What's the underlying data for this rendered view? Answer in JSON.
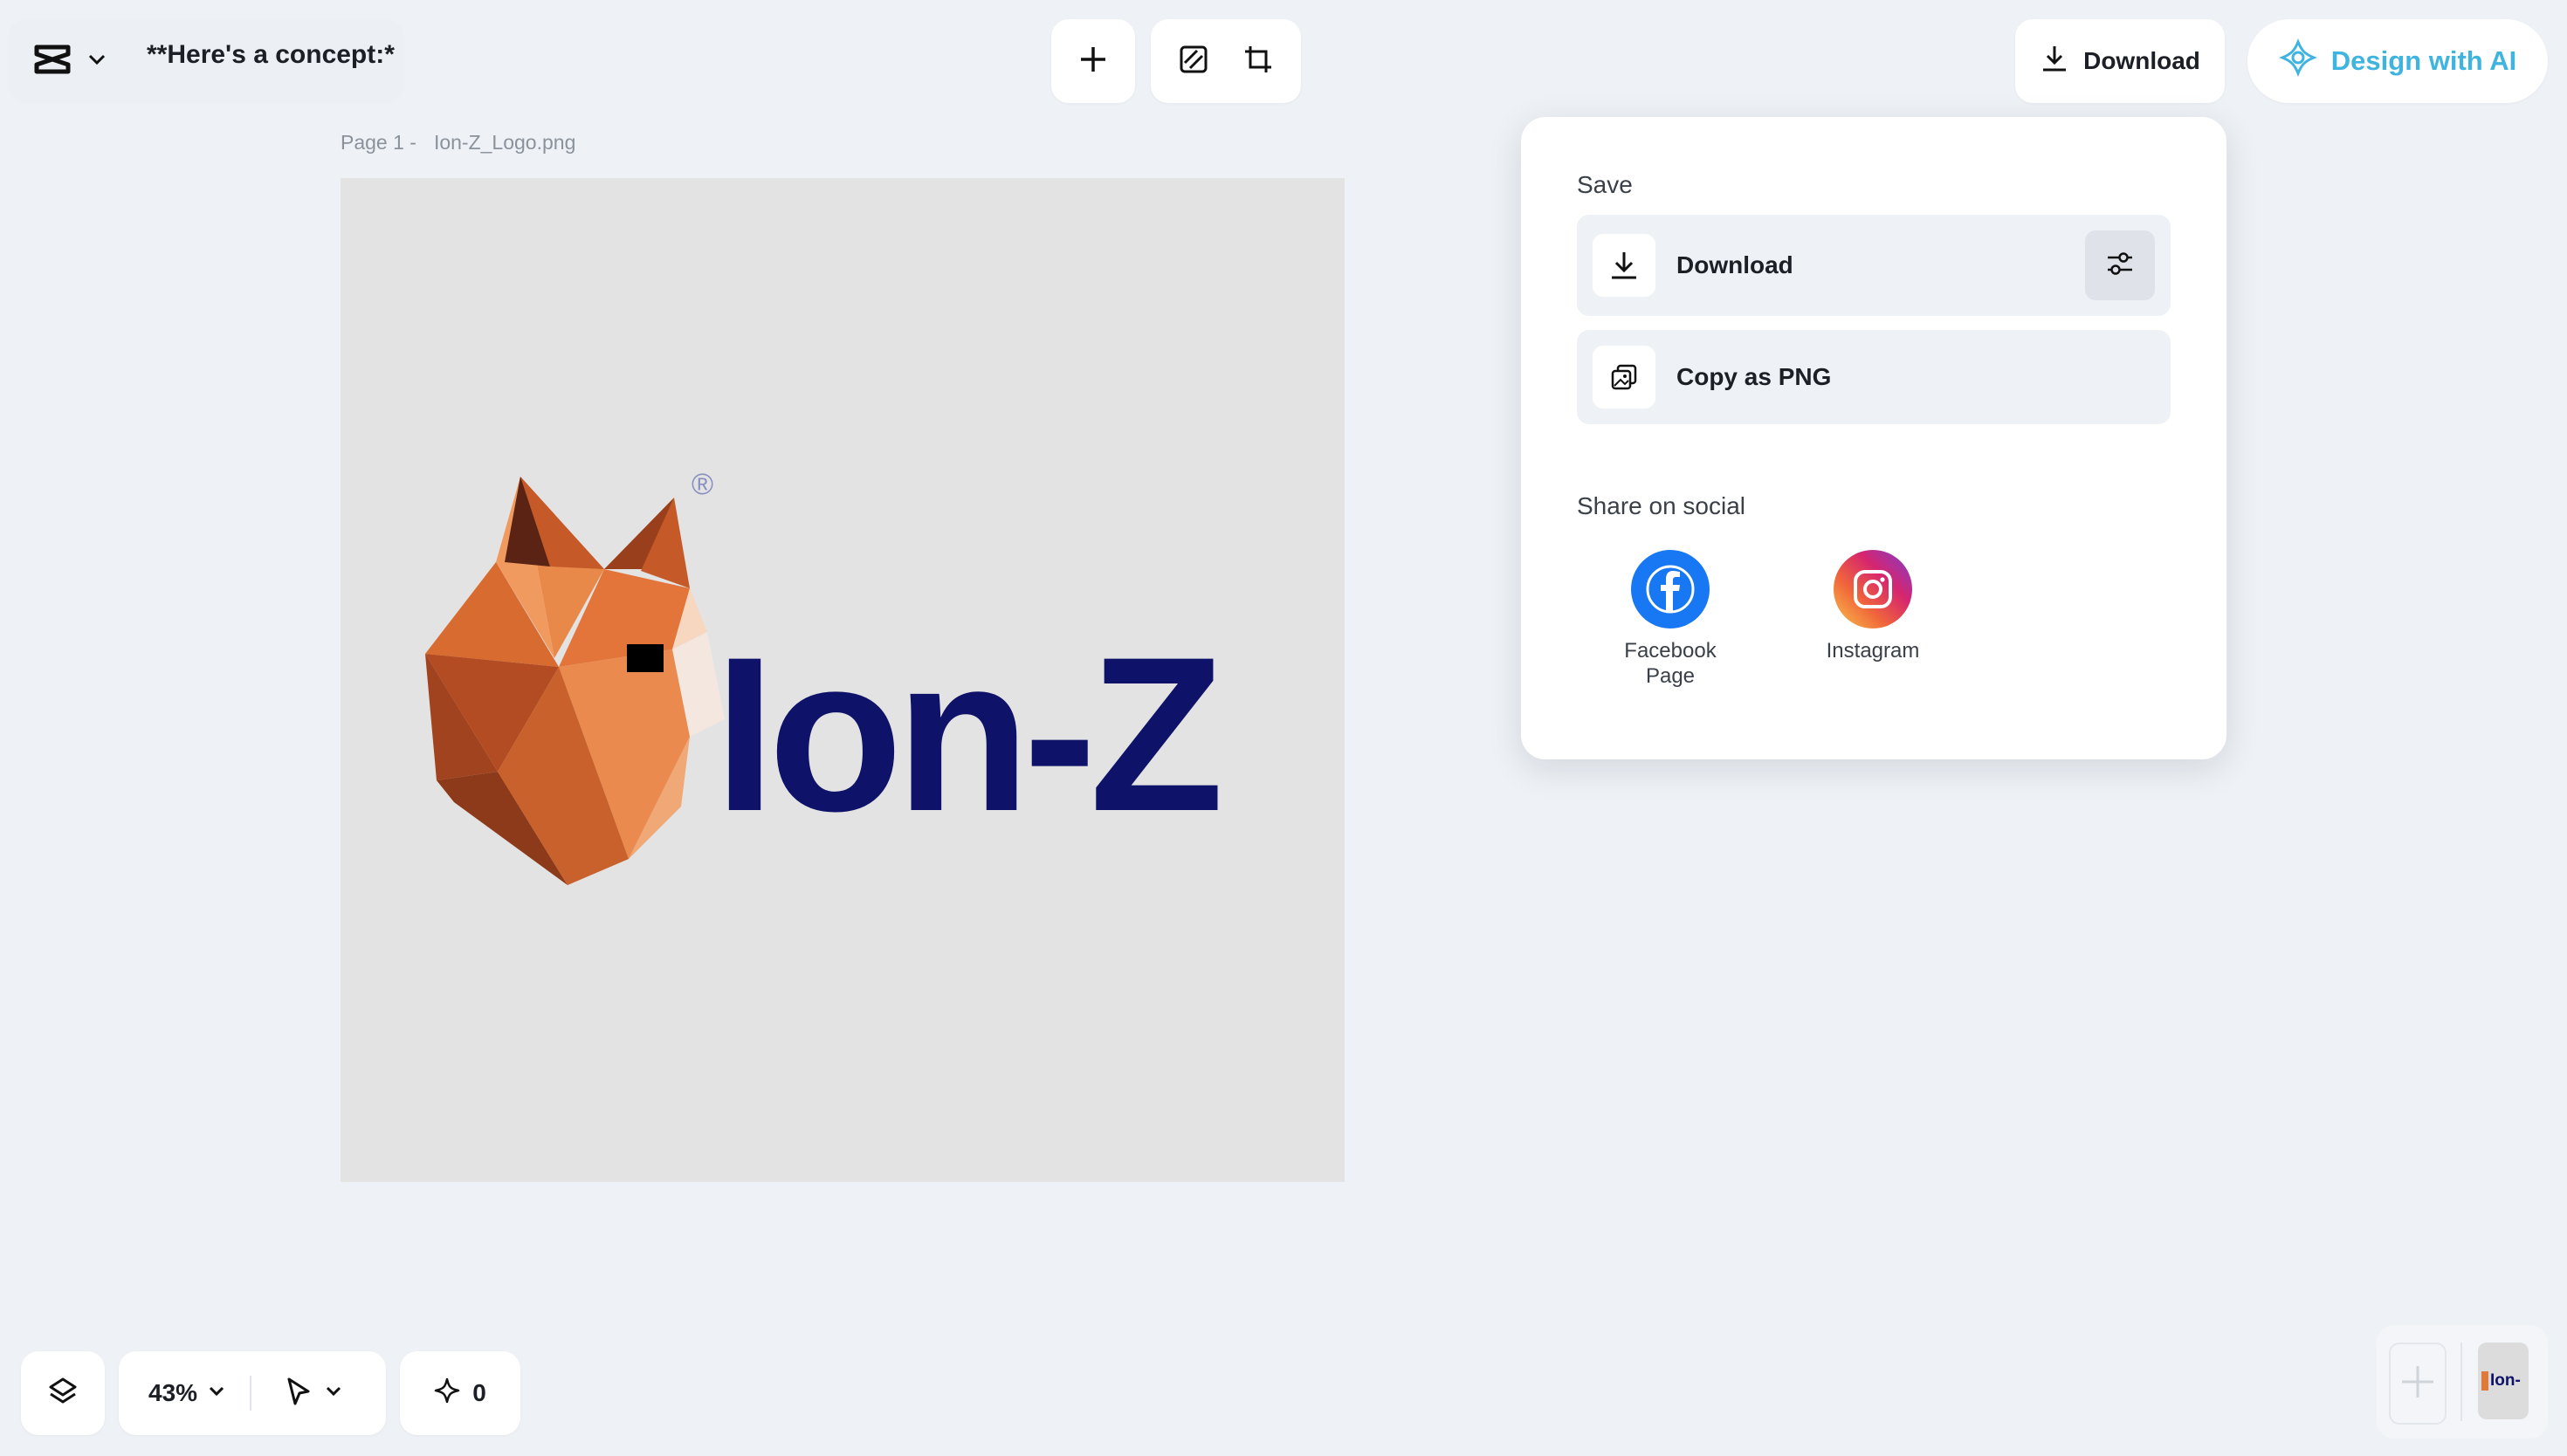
{
  "header": {
    "doc_title": "**Here's a concept:*",
    "download_label": "Download",
    "design_ai_label": "Design with AI"
  },
  "canvas": {
    "page_label": "Page 1 -",
    "file_name": "Ion-Z_Logo.png",
    "brand_text": "Ion-Z",
    "reg_mark": "®"
  },
  "popup": {
    "save_label": "Save",
    "download_label": "Download",
    "copy_png_label": "Copy as PNG",
    "share_label": "Share on social",
    "social": [
      {
        "label_line1": "Facebook",
        "label_line2": "Page"
      },
      {
        "label_line1": "Instagram",
        "label_line2": ""
      }
    ]
  },
  "footer": {
    "zoom": "43%",
    "credits": "0",
    "thumb_text": "Ion-"
  },
  "colors": {
    "accent_ai": "#3fb4e0",
    "brand_navy": "#0e1268",
    "facebook": "#1877f2",
    "fox_orange": "#e07a3c"
  },
  "icons": [
    "capcut-logo-icon",
    "chevron-down-icon",
    "plus-icon",
    "resize-icon",
    "crop-icon",
    "download-icon",
    "ai-sparkle-icon",
    "settings-sliders-icon",
    "copy-image-icon",
    "facebook-icon",
    "instagram-icon",
    "layers-icon",
    "cursor-icon",
    "sparkle-icon"
  ]
}
